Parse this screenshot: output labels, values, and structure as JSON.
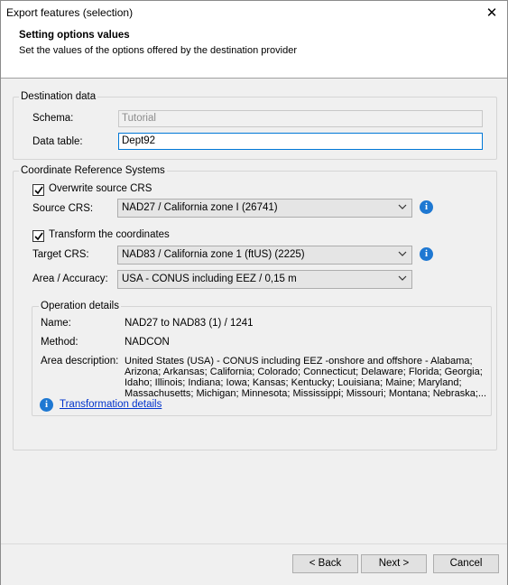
{
  "window": {
    "title": "Export features (selection)",
    "close_glyph": "✕"
  },
  "header": {
    "title": "Setting options values",
    "subtitle": "Set the values of the options offered by the destination provider"
  },
  "destination": {
    "legend": "Destination data",
    "schema_label": "Schema:",
    "schema_value": "Tutorial",
    "table_label": "Data table:",
    "table_value": "Dept92"
  },
  "crs": {
    "legend": "Coordinate Reference Systems",
    "overwrite_label": "Overwrite source CRS",
    "overwrite_checked": true,
    "source_label": "Source CRS:",
    "source_value": "NAD27 / California zone I (26741)",
    "transform_label": "Transform the coordinates",
    "transform_checked": true,
    "target_label": "Target CRS:",
    "target_value": "NAD83 / California zone 1 (ftUS) (2225)",
    "area_label": "Area / Accuracy:",
    "area_value": "USA - CONUS including EEZ / 0,15 m"
  },
  "operation": {
    "legend": "Operation details",
    "name_label": "Name:",
    "name_value": "NAD27 to NAD83 (1) / 1241",
    "method_label": "Method:",
    "method_value": "NADCON",
    "area_label": "Area description:",
    "area_value": "United States (USA) - CONUS including EEZ -onshore and offshore - Alabama; Arizona; Arkansas; California; Colorado; Connecticut; Delaware; Florida; Georgia; Idaho; Illinois; Indiana; Iowa; Kansas; Kentucky; Louisiana; Maine; Maryland; Massachusetts; Michigan; Minnesota; Mississippi; Missouri; Montana; Nebraska;...",
    "link_label": "Transformation details"
  },
  "buttons": {
    "back": "< Back",
    "next": "Next >",
    "cancel": "Cancel"
  },
  "icons": {
    "info": "info-icon",
    "check": "check-icon",
    "dropdown": "chevron-down-icon",
    "close": "close-icon"
  },
  "colors": {
    "accent": "#0078d7",
    "info": "#1e78d2",
    "link": "#0033cc"
  }
}
